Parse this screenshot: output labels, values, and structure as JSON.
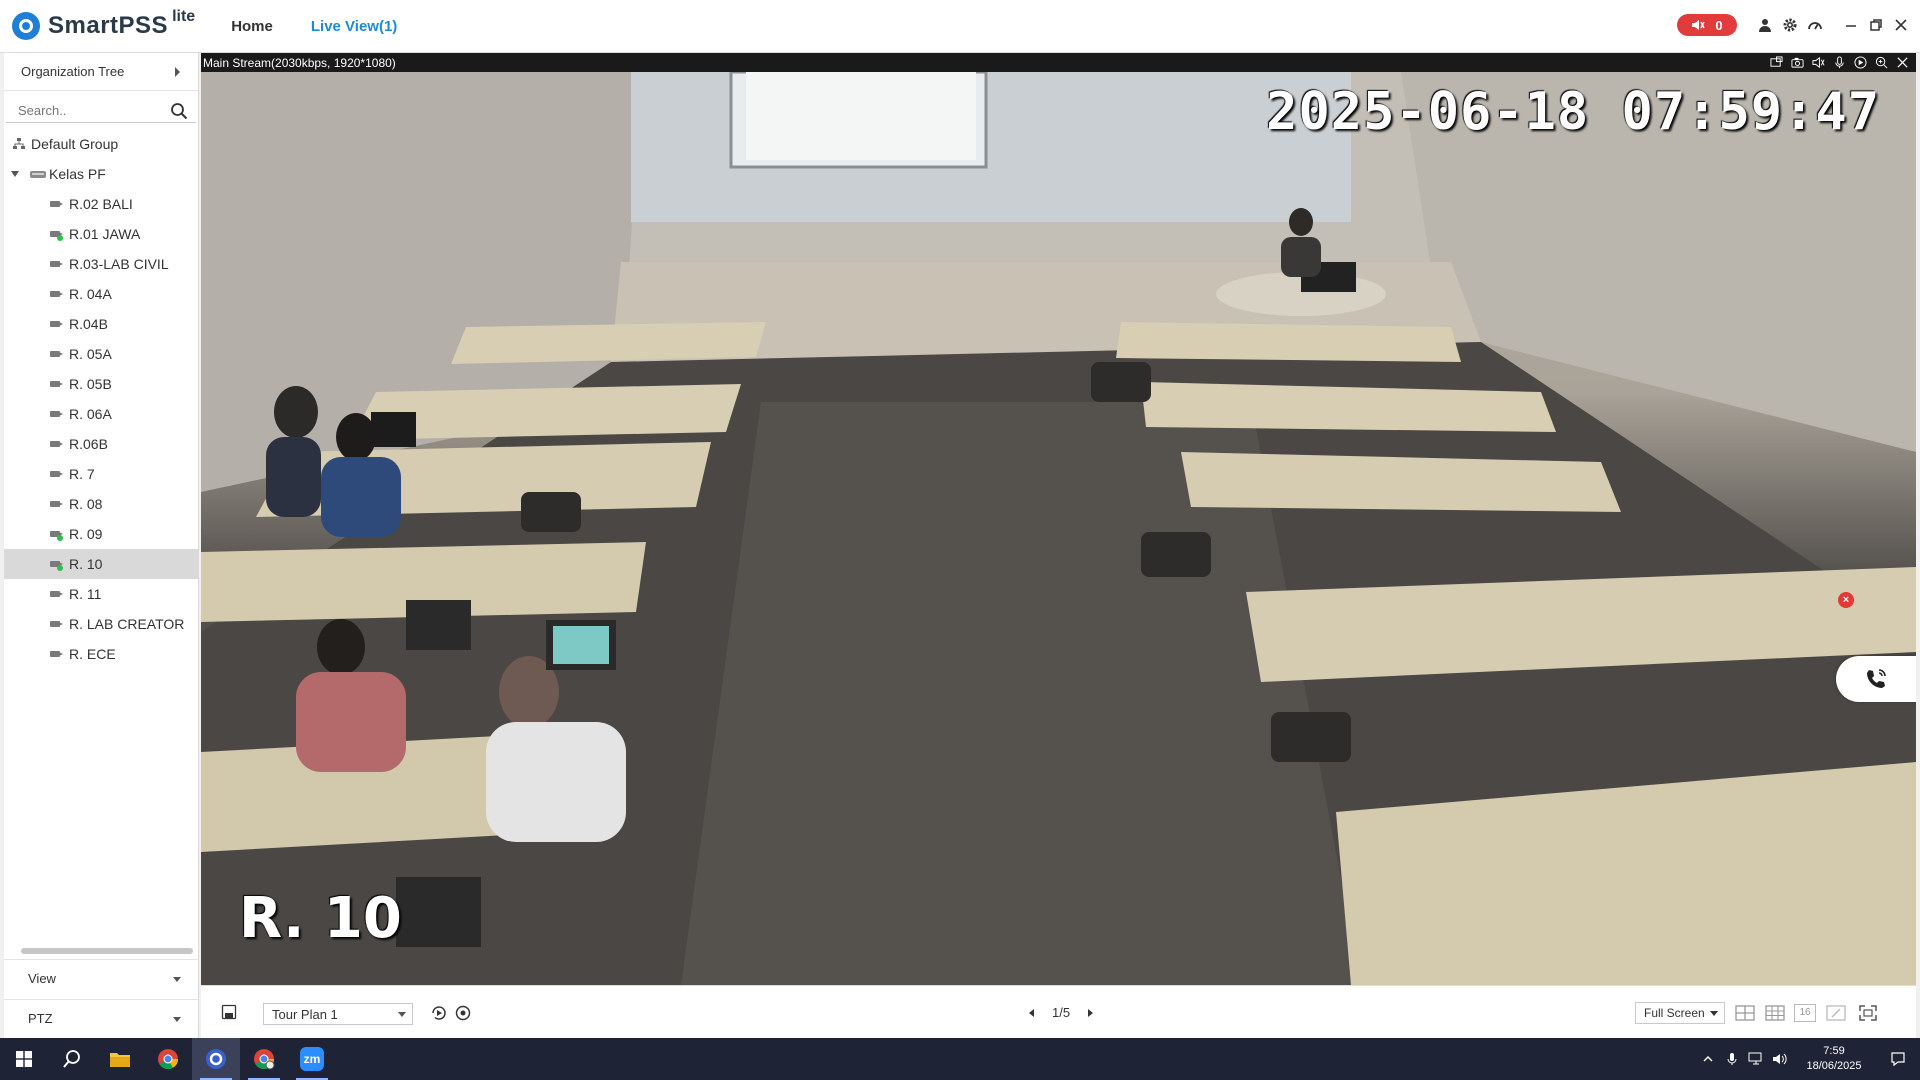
{
  "app": {
    "name": "SmartPSS",
    "name_suffix": "lite",
    "nav": {
      "home": "Home",
      "live_view": "Live View(1)"
    },
    "alarm_count": "0",
    "colors": {
      "accent": "#1d8ad6",
      "alarm": "#e23b3b",
      "online": "#2ec04a"
    }
  },
  "sidebar": {
    "org_tree_label": "Organization Tree",
    "search_placeholder": "Search..",
    "default_group": "Default Group",
    "group": "Kelas PF",
    "devices": [
      {
        "label": "R.02 BALI",
        "online": false
      },
      {
        "label": "R.01 JAWA",
        "online": true
      },
      {
        "label": "R.03-LAB CIVIL",
        "online": false
      },
      {
        "label": "R. 04A",
        "online": false
      },
      {
        "label": "R.04B",
        "online": false
      },
      {
        "label": "R. 05A",
        "online": false
      },
      {
        "label": "R. 05B",
        "online": false
      },
      {
        "label": "R. 06A",
        "online": false
      },
      {
        "label": "R.06B",
        "online": false
      },
      {
        "label": "R. 7",
        "online": false
      },
      {
        "label": "R. 08",
        "online": false
      },
      {
        "label": "R. 09",
        "online": true
      },
      {
        "label": "R. 10",
        "online": true,
        "selected": true
      },
      {
        "label": "R. 11",
        "online": false
      },
      {
        "label": "R. LAB CREATOR",
        "online": false
      },
      {
        "label": "R. ECE",
        "online": false
      }
    ],
    "view_label": "View",
    "ptz_label": "PTZ"
  },
  "video": {
    "stream_info": "Main Stream(2030kbps, 1920*1080)",
    "osd_time": "2025-06-18  07:59:47",
    "osd_channel": "R. 10"
  },
  "toolbar": {
    "tour_plan": "Tour Plan 1",
    "page": "1/5",
    "screen_mode": "Full Screen",
    "layout_16": "16"
  },
  "taskbar": {
    "time": "7:59",
    "date": "18/06/2025",
    "zoom_label": "zm"
  }
}
